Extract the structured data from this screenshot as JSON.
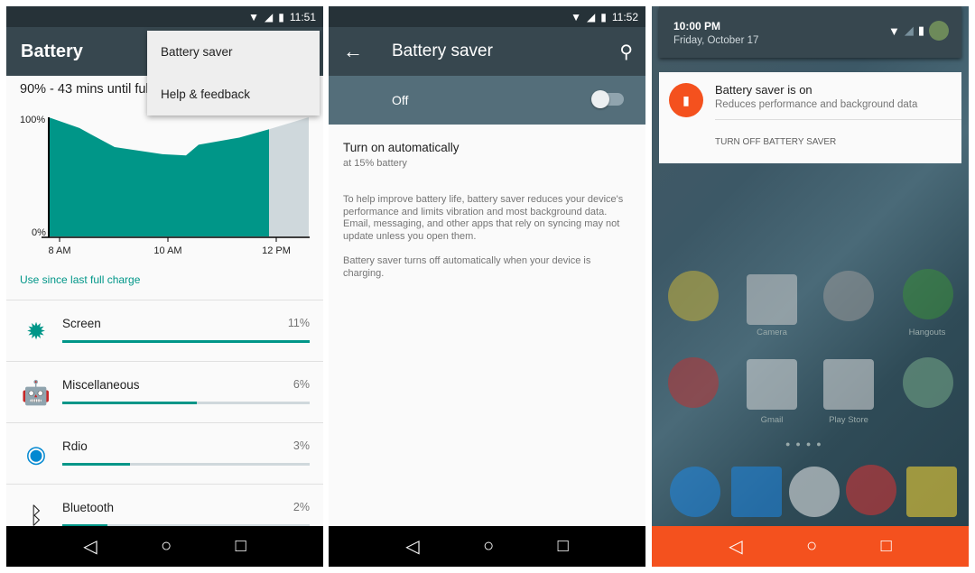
{
  "battery": {
    "time": "11:51",
    "title": "Battery",
    "status": "90% - 43 mins until full",
    "menu": [
      "Battery saver",
      "Help & feedback"
    ],
    "chart": {
      "type": "area",
      "ylabels": [
        "100%",
        "0%"
      ],
      "xlabels": [
        "8 AM",
        "10 AM",
        "12 PM"
      ],
      "ylim": [
        0,
        100
      ],
      "actual": [
        [
          "7:48",
          100
        ],
        [
          "8:22",
          91
        ],
        [
          "8:34",
          86
        ],
        [
          "9:01",
          75
        ],
        [
          "9:54",
          69
        ],
        [
          "10:20",
          68
        ],
        [
          "10:34",
          77
        ],
        [
          "11:19",
          83
        ],
        [
          "11:52",
          90
        ]
      ],
      "projected": [
        [
          "11:52",
          90
        ],
        [
          "12:36",
          100
        ]
      ],
      "colors": {
        "actual": "#009688",
        "projected": "#cfd8dc"
      }
    },
    "use_since": "Use since last full charge",
    "items": [
      {
        "name": "Screen",
        "pct": "11%",
        "value": 11,
        "icon": "brightness-icon"
      },
      {
        "name": "Miscellaneous",
        "pct": "6%",
        "value": 6,
        "icon": "android-icon"
      },
      {
        "name": "Rdio",
        "pct": "3%",
        "value": 3,
        "icon": "rdio-icon"
      },
      {
        "name": "Bluetooth",
        "pct": "2%",
        "value": 2,
        "icon": "bluetooth-icon"
      }
    ]
  },
  "saver": {
    "time": "11:52",
    "title": "Battery saver",
    "switch_label": "Off",
    "auto_title": "Turn on automatically",
    "auto_sub": "at 15% battery",
    "desc1": "To help improve battery life, battery saver reduces your device's performance and limits vibration and most background data. Email, messaging, and other apps that rely on syncing may not update unless you open them.",
    "desc2": "Battery saver turns off automatically when your device is charging."
  },
  "notif": {
    "time": "10:00 PM",
    "date": "Friday, October 17",
    "title": "Battery saver is on",
    "text": "Reduces performance and background data",
    "action": "TURN OFF BATTERY SAVER",
    "apps": [
      "Camera",
      "Hangouts",
      "Gmail",
      "Play Store"
    ],
    "accent": "#f4511e"
  }
}
